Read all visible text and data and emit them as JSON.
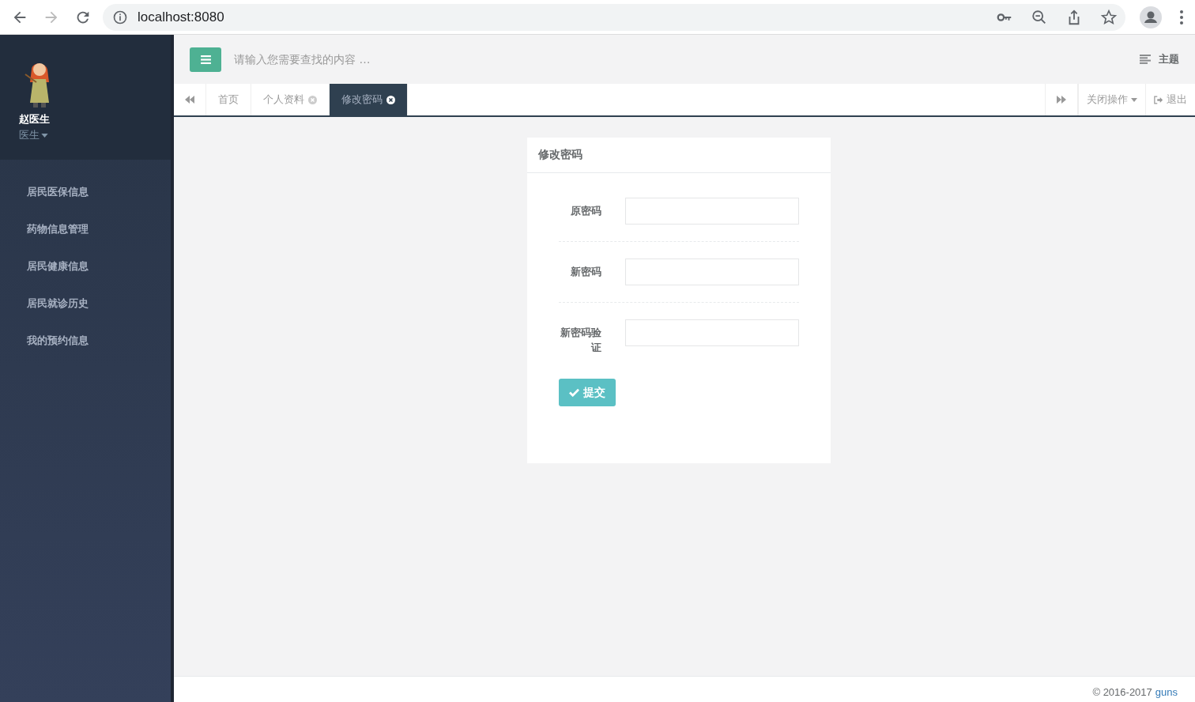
{
  "browser": {
    "address": "localhost:8080"
  },
  "sidebar": {
    "user_name": "赵医生",
    "role": "医生",
    "items": [
      {
        "label": "居民医保信息"
      },
      {
        "label": "药物信息管理"
      },
      {
        "label": "居民健康信息"
      },
      {
        "label": "居民就诊历史"
      },
      {
        "label": "我的预约信息"
      }
    ]
  },
  "header": {
    "search_placeholder": "请输入您需要查找的内容 …",
    "theme_label": "主题"
  },
  "tabs": [
    {
      "label": "首页",
      "closable": false,
      "selected": false
    },
    {
      "label": "个人资料",
      "closable": true,
      "selected": false
    },
    {
      "label": "修改密码",
      "closable": true,
      "selected": true
    }
  ],
  "tab_actions": {
    "close_menu": "关闭操作",
    "logout": "退出"
  },
  "form": {
    "title": "修改密码",
    "fields": [
      {
        "label": "原密码"
      },
      {
        "label": "新密码"
      },
      {
        "label": "新密码验证"
      }
    ],
    "submit": "提交"
  },
  "footer": {
    "copyright": "© 2016-2017",
    "link": "guns"
  }
}
